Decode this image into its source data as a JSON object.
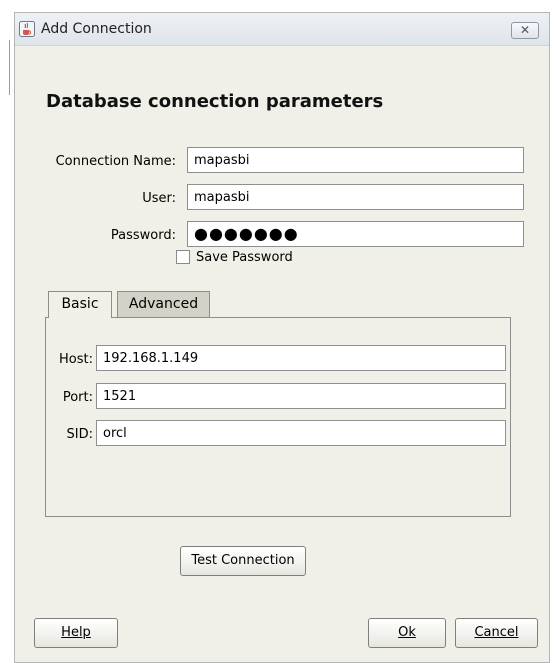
{
  "window": {
    "title": "Add Connection",
    "close_glyph": "✕",
    "icon": "java-cup-icon"
  },
  "heading": "Database connection parameters",
  "form": {
    "connection_name": {
      "label": "Connection Name:",
      "value": "mapasbi"
    },
    "user": {
      "label": "User:",
      "value": "mapasbi"
    },
    "password": {
      "label": "Password:",
      "value": "●●●●●●●"
    },
    "save_password": {
      "label": "Save Password",
      "checked": false
    }
  },
  "tabs": [
    {
      "label": "Basic",
      "selected": true
    },
    {
      "label": "Advanced",
      "selected": false
    }
  ],
  "basic": {
    "host": {
      "label": "Host:",
      "value": "192.168.1.149"
    },
    "port": {
      "label": "Port:",
      "value": "1521"
    },
    "sid": {
      "label": "SID:",
      "value": "orcl"
    }
  },
  "buttons": {
    "test": "Test Connection",
    "help": "Help",
    "ok": "Ok",
    "cancel": "Cancel"
  }
}
